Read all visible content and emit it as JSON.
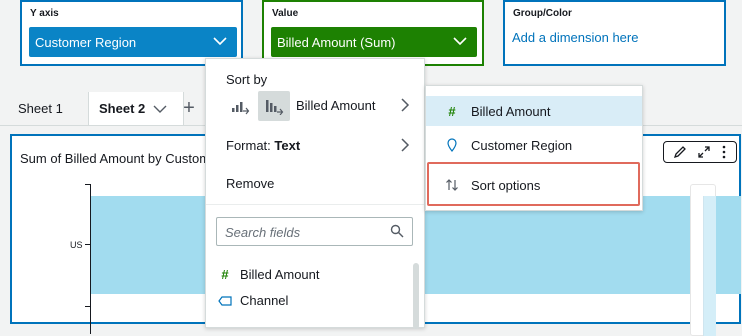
{
  "wells": {
    "y_axis": {
      "label": "Y axis",
      "field": "Customer Region"
    },
    "value": {
      "label": "Value",
      "field": "Billed Amount (Sum)"
    },
    "group": {
      "label": "Group/Color",
      "placeholder": "Add a dimension here"
    }
  },
  "tabs": [
    {
      "label": "Sheet 1"
    },
    {
      "label": "Sheet 2"
    }
  ],
  "visual": {
    "title": "Sum of Billed Amount by Customer Region",
    "y_category": "US"
  },
  "menu": {
    "sort_by_label": "Sort by",
    "sort_field": "Billed Amount",
    "format_label": "Format:",
    "format_value": "Text",
    "remove_label": "Remove",
    "search_placeholder": "Search fields",
    "fields": [
      {
        "name": "Billed Amount",
        "icon": "measure-hash-icon"
      },
      {
        "name": "Channel",
        "icon": "dimension-tag-icon"
      }
    ]
  },
  "submenu": {
    "items": [
      {
        "label": "Billed Amount",
        "icon": "measure-hash-icon"
      },
      {
        "label": "Customer Region",
        "icon": "geo-pin-icon"
      },
      {
        "label": "Sort options",
        "icon": "sort-arrows-icon"
      }
    ]
  },
  "colors": {
    "accent_blue": "#0073bb",
    "value_green": "#1d8102",
    "bar": "#a2dcef",
    "highlight_red": "#e06a5c"
  }
}
